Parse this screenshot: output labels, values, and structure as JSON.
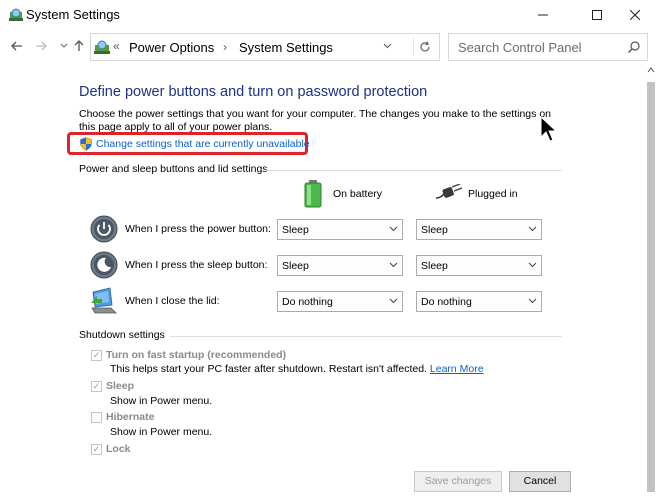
{
  "window": {
    "title": "System Settings"
  },
  "nav": {
    "address": {
      "separator": "«",
      "crumbs": [
        "Power Options",
        "System Settings"
      ],
      "crumb_separator": "›"
    },
    "search": {
      "placeholder": "Search Control Panel"
    }
  },
  "main": {
    "heading": "Define power buttons and turn on password protection",
    "description": "Choose the power settings that you want for your computer. The changes you make to the settings on this page apply to all of your power plans.",
    "unavailable_link": "Change settings that are currently unavailable",
    "power_section": {
      "title": "Power and sleep buttons and lid settings",
      "columns": {
        "battery": "On battery",
        "plugged": "Plugged in"
      },
      "rows": [
        {
          "label": "When I press the power button:",
          "battery": "Sleep",
          "plugged": "Sleep",
          "icon": "power-button-icon"
        },
        {
          "label": "When I press the sleep button:",
          "battery": "Sleep",
          "plugged": "Sleep",
          "icon": "sleep-button-icon"
        },
        {
          "label": "When I close the lid:",
          "battery": "Do nothing",
          "plugged": "Do nothing",
          "icon": "laptop-lid-icon"
        }
      ]
    },
    "shutdown_section": {
      "title": "Shutdown settings",
      "items": [
        {
          "label": "Turn on fast startup (recommended)",
          "checked": true,
          "sub": "This helps start your PC faster after shutdown. Restart isn't affected.",
          "link": "Learn More"
        },
        {
          "label": "Sleep",
          "checked": true,
          "sub": "Show in Power menu."
        },
        {
          "label": "Hibernate",
          "checked": false,
          "sub": "Show in Power menu."
        },
        {
          "label": "Lock",
          "checked": true
        }
      ]
    }
  },
  "footer": {
    "save_label": "Save changes",
    "cancel_label": "Cancel"
  },
  "colors": {
    "heading": "#1e3287",
    "link": "#0b5fd0",
    "highlight_box": "#e0232b"
  }
}
